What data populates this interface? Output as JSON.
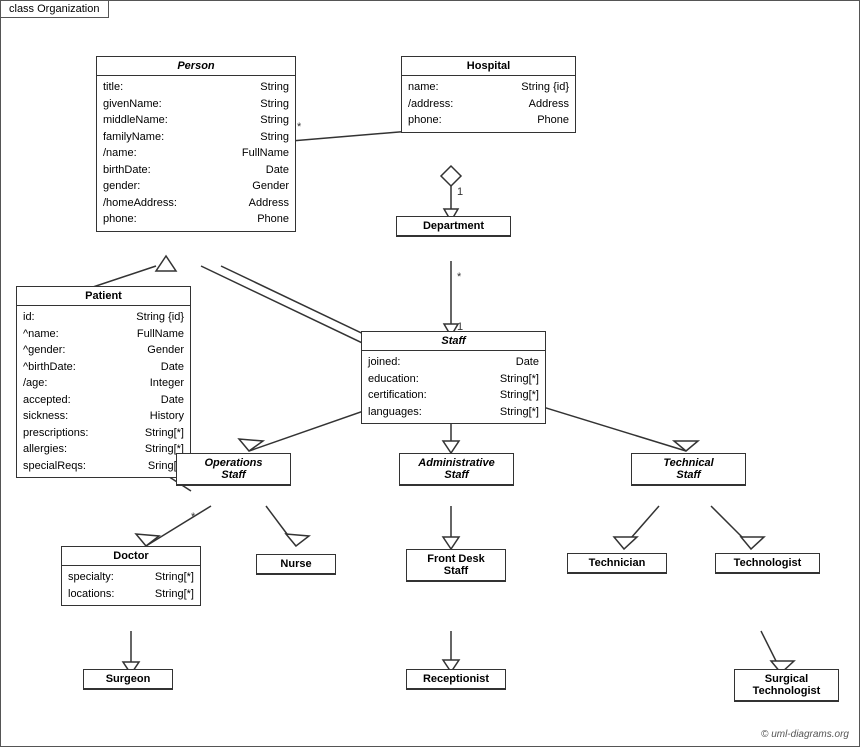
{
  "diagram": {
    "title": "class Organization",
    "copyright": "© uml-diagrams.org",
    "classes": {
      "person": {
        "name": "Person",
        "italic": true,
        "attributes": [
          {
            "name": "title:",
            "type": "String"
          },
          {
            "name": "givenName:",
            "type": "String"
          },
          {
            "name": "middleName:",
            "type": "String"
          },
          {
            "name": "familyName:",
            "type": "String"
          },
          {
            "name": "/name:",
            "type": "FullName"
          },
          {
            "name": "birthDate:",
            "type": "Date"
          },
          {
            "name": "gender:",
            "type": "Gender"
          },
          {
            "name": "/homeAddress:",
            "type": "Address"
          },
          {
            "name": "phone:",
            "type": "Phone"
          }
        ]
      },
      "hospital": {
        "name": "Hospital",
        "italic": false,
        "attributes": [
          {
            "name": "name:",
            "type": "String {id}"
          },
          {
            "name": "/address:",
            "type": "Address"
          },
          {
            "name": "phone:",
            "type": "Phone"
          }
        ]
      },
      "patient": {
        "name": "Patient",
        "italic": false,
        "attributes": [
          {
            "name": "id:",
            "type": "String {id}"
          },
          {
            "name": "^name:",
            "type": "FullName"
          },
          {
            "name": "^gender:",
            "type": "Gender"
          },
          {
            "name": "^birthDate:",
            "type": "Date"
          },
          {
            "name": "/age:",
            "type": "Integer"
          },
          {
            "name": "accepted:",
            "type": "Date"
          },
          {
            "name": "sickness:",
            "type": "History"
          },
          {
            "name": "prescriptions:",
            "type": "String[*]"
          },
          {
            "name": "allergies:",
            "type": "String[*]"
          },
          {
            "name": "specialReqs:",
            "type": "Sring[*]"
          }
        ]
      },
      "department": {
        "name": "Department",
        "italic": false,
        "attributes": []
      },
      "staff": {
        "name": "Staff",
        "italic": true,
        "attributes": [
          {
            "name": "joined:",
            "type": "Date"
          },
          {
            "name": "education:",
            "type": "String[*]"
          },
          {
            "name": "certification:",
            "type": "String[*]"
          },
          {
            "name": "languages:",
            "type": "String[*]"
          }
        ]
      },
      "operations_staff": {
        "name": "Operations\nStaff",
        "italic": true,
        "attributes": []
      },
      "administrative_staff": {
        "name": "Administrative\nStaff",
        "italic": true,
        "attributes": []
      },
      "technical_staff": {
        "name": "Technical\nStaff",
        "italic": true,
        "attributes": []
      },
      "doctor": {
        "name": "Doctor",
        "italic": false,
        "attributes": [
          {
            "name": "specialty:",
            "type": "String[*]"
          },
          {
            "name": "locations:",
            "type": "String[*]"
          }
        ]
      },
      "nurse": {
        "name": "Nurse",
        "italic": false,
        "attributes": []
      },
      "front_desk_staff": {
        "name": "Front Desk\nStaff",
        "italic": false,
        "attributes": []
      },
      "technician": {
        "name": "Technician",
        "italic": false,
        "attributes": []
      },
      "technologist": {
        "name": "Technologist",
        "italic": false,
        "attributes": []
      },
      "surgeon": {
        "name": "Surgeon",
        "italic": false,
        "attributes": []
      },
      "receptionist": {
        "name": "Receptionist",
        "italic": false,
        "attributes": []
      },
      "surgical_technologist": {
        "name": "Surgical\nTechnologist",
        "italic": false,
        "attributes": []
      }
    }
  }
}
